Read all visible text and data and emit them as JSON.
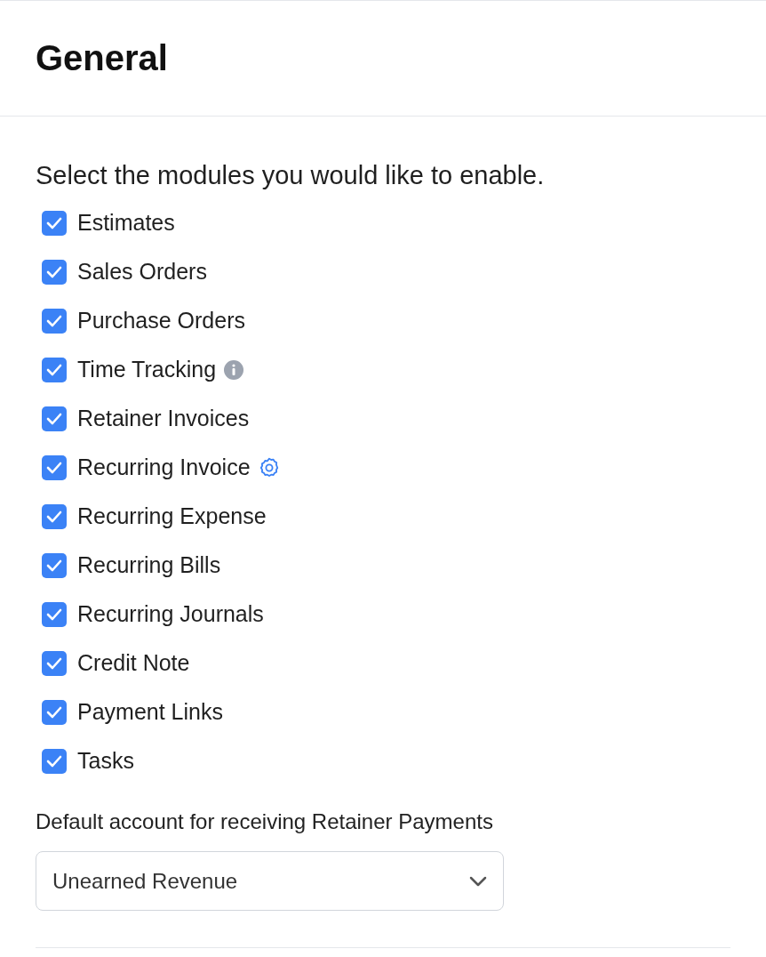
{
  "header": {
    "title": "General"
  },
  "modules": {
    "prompt": "Select the modules you would like to enable.",
    "items": [
      {
        "label": "Estimates",
        "checked": true,
        "kind": "plain"
      },
      {
        "label": "Sales Orders",
        "checked": true,
        "kind": "plain"
      },
      {
        "label": "Purchase Orders",
        "checked": true,
        "kind": "plain"
      },
      {
        "label": "Time Tracking",
        "checked": true,
        "kind": "info"
      },
      {
        "label": "Retainer Invoices",
        "checked": true,
        "kind": "plain"
      },
      {
        "label": "Recurring Invoice",
        "checked": true,
        "kind": "settings"
      },
      {
        "label": "Recurring Expense",
        "checked": true,
        "kind": "plain"
      },
      {
        "label": "Recurring Bills",
        "checked": true,
        "kind": "plain"
      },
      {
        "label": "Recurring Journals",
        "checked": true,
        "kind": "plain"
      },
      {
        "label": "Credit Note",
        "checked": true,
        "kind": "plain"
      },
      {
        "label": "Payment Links",
        "checked": true,
        "kind": "plain"
      },
      {
        "label": "Tasks",
        "checked": true,
        "kind": "plain"
      }
    ]
  },
  "retainer_account": {
    "label": "Default account for receiving Retainer Payments",
    "value": "Unearned Revenue"
  }
}
